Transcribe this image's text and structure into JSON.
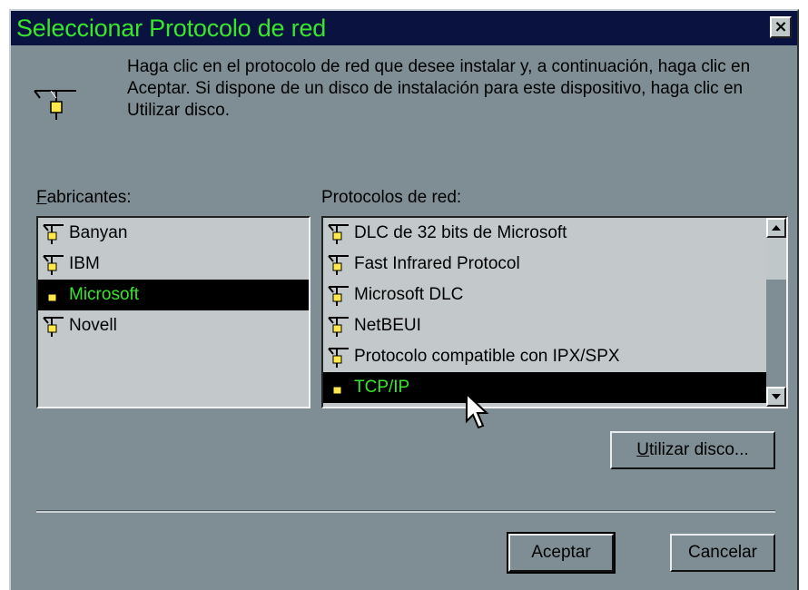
{
  "window": {
    "title": "Seleccionar Protocolo de red",
    "close_label": "×"
  },
  "instructions": {
    "text": "Haga clic en el protocolo de red que desee instalar y, a continuación, haga clic en Aceptar. Si dispone de un disco de instalación para este dispositivo, haga clic en Utilizar disco."
  },
  "manufacturers": {
    "label_accel": "F",
    "label_rest": "abricantes:",
    "items": [
      {
        "label": "Banyan",
        "selected": false
      },
      {
        "label": "IBM",
        "selected": false
      },
      {
        "label": "Microsoft",
        "selected": true
      },
      {
        "label": "Novell",
        "selected": false
      }
    ]
  },
  "protocols": {
    "label": "Protocolos de red:",
    "items": [
      {
        "label": "DLC de 32 bits de Microsoft",
        "selected": false
      },
      {
        "label": "Fast Infrared Protocol",
        "selected": false
      },
      {
        "label": "Microsoft DLC",
        "selected": false
      },
      {
        "label": "NetBEUI",
        "selected": false
      },
      {
        "label": "Protocolo compatible con IPX/SPX",
        "selected": false
      },
      {
        "label": "TCP/IP",
        "selected": true
      }
    ]
  },
  "buttons": {
    "have_disk_accel": "U",
    "have_disk_rest": "tilizar disco...",
    "ok": "Aceptar",
    "cancel": "Cancelar"
  },
  "icons": {
    "header": "network-protocol-icon",
    "list_item": "network-protocol-icon",
    "cursor": "arrow-cursor-icon"
  },
  "colors": {
    "dialog_bg": "#7f8e94",
    "title_bg": "#0a1240",
    "title_text": "#38e62c",
    "selection_bg": "#000000",
    "selection_text": "#38e62c"
  }
}
